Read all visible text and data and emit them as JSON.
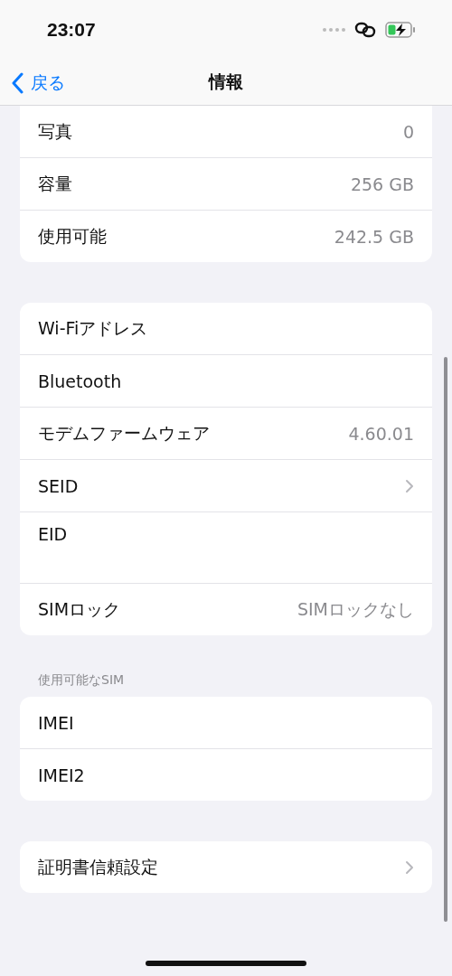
{
  "status_bar": {
    "time": "23:07"
  },
  "nav": {
    "back": "戻る",
    "title": "情報"
  },
  "groups": [
    {
      "cut_top": true,
      "rows": [
        {
          "kind": "value",
          "label": "写真",
          "value": "0"
        },
        {
          "kind": "value",
          "label": "容量",
          "value": "256 GB"
        },
        {
          "kind": "value",
          "label": "使用可能",
          "value": "242.5 GB"
        }
      ]
    },
    {
      "cut_top": false,
      "rows": [
        {
          "kind": "plain",
          "label": "Wi-Fiアドレス"
        },
        {
          "kind": "plain",
          "label": "Bluetooth"
        },
        {
          "kind": "value",
          "label": "モデムファームウェア",
          "value": "4.60.01"
        },
        {
          "kind": "chevron",
          "label": "SEID"
        },
        {
          "kind": "tall",
          "label": "EID"
        },
        {
          "kind": "value",
          "label": "SIMロック",
          "value": "SIMロックなし"
        }
      ]
    },
    {
      "cut_top": false,
      "header": "使用可能なSIM",
      "rows": [
        {
          "kind": "plain",
          "label": "IMEI"
        },
        {
          "kind": "plain",
          "label": "IMEI2"
        }
      ]
    },
    {
      "cut_top": false,
      "rows": [
        {
          "kind": "chevron",
          "label": "証明書信頼設定"
        }
      ]
    }
  ]
}
